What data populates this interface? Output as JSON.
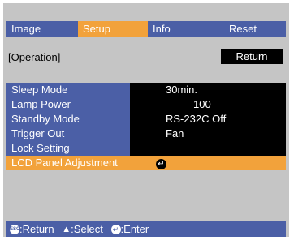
{
  "tabs": [
    {
      "label": "Image"
    },
    {
      "label": "Setup"
    },
    {
      "label": "Info"
    },
    {
      "label": "Reset"
    }
  ],
  "section_label": "[Operation]",
  "return_button": "Return",
  "rows": [
    {
      "label": "Sleep Mode",
      "value": "30min."
    },
    {
      "label": "Lamp Power",
      "value": "100"
    },
    {
      "label": "Standby Mode",
      "value": "RS-232C Off"
    },
    {
      "label": "Trigger Out",
      "value": "Fan"
    },
    {
      "label": "Lock Setting",
      "value": ""
    },
    {
      "label": "LCD Panel Adjustment",
      "value": ""
    }
  ],
  "footer": {
    "esc_icon_text": "ESC",
    "return_label": ":Return",
    "select_label": ":Select",
    "enter_label": ":Enter"
  },
  "colors": {
    "menu_blue": "#4b5fa6",
    "highlight_orange": "#f2a23b",
    "background_gray": "#c5c5c5"
  }
}
